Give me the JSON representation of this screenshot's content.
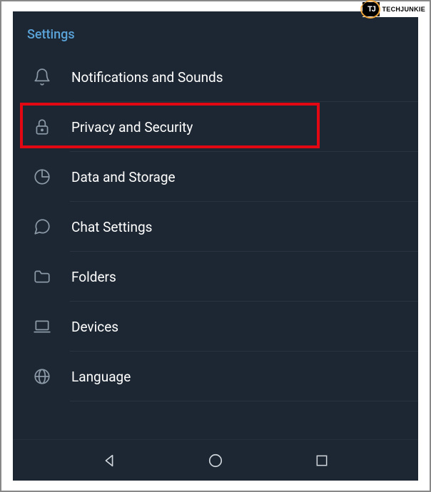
{
  "watermark": {
    "logo_text": "TJ",
    "brand_text": "TECHJUNKIE"
  },
  "section_header": "Settings",
  "items": [
    {
      "id": "notifications",
      "label": "Notifications and Sounds",
      "icon": "bell-icon",
      "highlighted": false
    },
    {
      "id": "privacy",
      "label": "Privacy and Security",
      "icon": "lock-icon",
      "highlighted": true
    },
    {
      "id": "data",
      "label": "Data and Storage",
      "icon": "pie-icon",
      "highlighted": false
    },
    {
      "id": "chat",
      "label": "Chat Settings",
      "icon": "chat-icon",
      "highlighted": false
    },
    {
      "id": "folders",
      "label": "Folders",
      "icon": "folder-icon",
      "highlighted": false
    },
    {
      "id": "devices",
      "label": "Devices",
      "icon": "laptop-icon",
      "highlighted": false
    },
    {
      "id": "language",
      "label": "Language",
      "icon": "globe-icon",
      "highlighted": false
    }
  ],
  "colors": {
    "background": "#1d2733",
    "header_text": "#5aa3d8",
    "item_text": "#ffffff",
    "icon": "#8c99a6",
    "highlight_border": "#e30613"
  }
}
